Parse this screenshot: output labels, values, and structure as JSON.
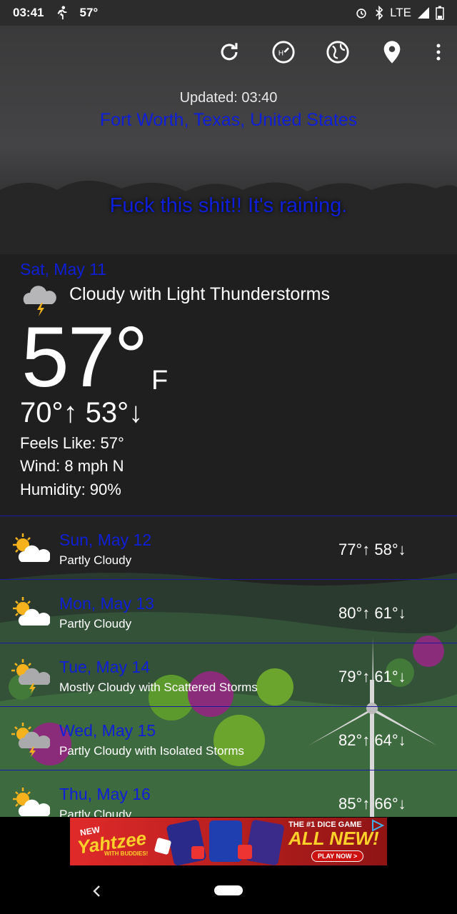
{
  "status_bar": {
    "time": "03:41",
    "temp": "57°",
    "network": "LTE"
  },
  "header": {
    "updated": "Updated: 03:40",
    "location": "Fort Worth, Texas, United States"
  },
  "message": "Fuck this shit!! It's raining.",
  "current": {
    "date": "Sat, May 11",
    "condition": "Cloudy with Light Thunderstorms",
    "temp": "57°",
    "unit": "F",
    "hilo": "70°↑ 53°↓",
    "feels_like": "Feels Like: 57°",
    "wind": "Wind: 8 mph N",
    "humidity": "Humidity: 90%",
    "icon": "storm-cloud-icon"
  },
  "forecast": [
    {
      "date": "Sun, May 12",
      "condition": "Partly Cloudy",
      "temps": "77°↑ 58°↓",
      "icon": "partly-cloudy-icon"
    },
    {
      "date": "Mon, May 13",
      "condition": "Partly Cloudy",
      "temps": "80°↑ 61°↓",
      "icon": "partly-cloudy-icon"
    },
    {
      "date": "Tue, May 14",
      "condition": "Mostly Cloudy with Scattered Storms",
      "temps": "79°↑ 61°↓",
      "icon": "sun-storm-icon"
    },
    {
      "date": "Wed, May 15",
      "condition": "Partly Cloudy with Isolated Storms",
      "temps": "82°↑ 64°↓",
      "icon": "sun-storm-icon"
    },
    {
      "date": "Thu, May 16",
      "condition": "Partly Cloudy",
      "temps": "85°↑ 66°↓",
      "icon": "partly-cloudy-icon"
    }
  ],
  "ad": {
    "new": "NEW",
    "brand": "Yahtzee",
    "with": "WITH BUDDIES!",
    "tagline": "THE #1 DICE GAME",
    "headline": "ALL NEW!",
    "cta": "PLAY NOW >"
  },
  "colors": {
    "accent_text": "#0f1fd8",
    "background": "#1f1f20"
  }
}
